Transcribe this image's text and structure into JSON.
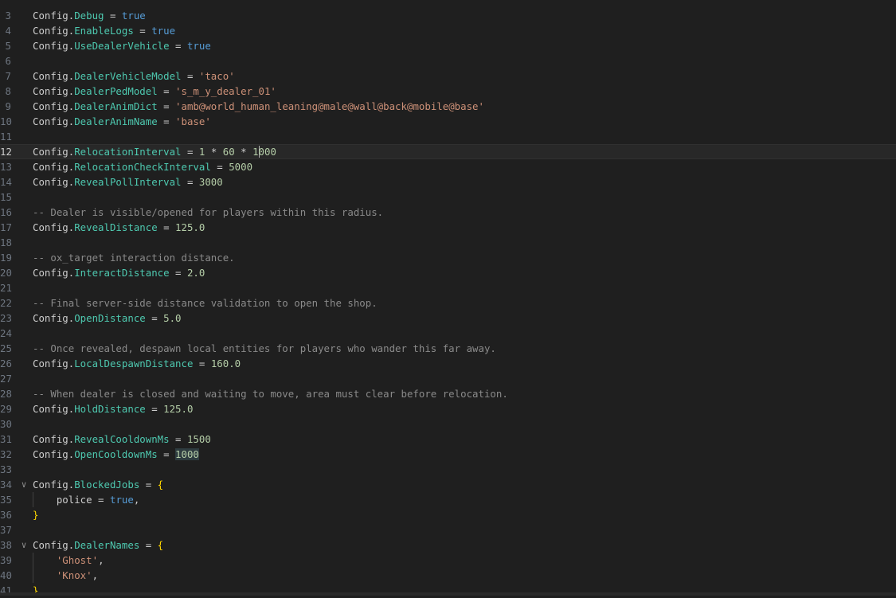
{
  "editor": {
    "cursor_line": "12",
    "lines": [
      {
        "n": "3",
        "tokens": [
          [
            "plain",
            "Config."
          ],
          [
            "prop",
            "Debug"
          ],
          [
            "plain",
            " = "
          ],
          [
            "bool",
            "true"
          ]
        ]
      },
      {
        "n": "4",
        "tokens": [
          [
            "plain",
            "Config."
          ],
          [
            "prop",
            "EnableLogs"
          ],
          [
            "plain",
            " = "
          ],
          [
            "bool",
            "true"
          ]
        ]
      },
      {
        "n": "5",
        "tokens": [
          [
            "plain",
            "Config."
          ],
          [
            "prop",
            "UseDealerVehicle"
          ],
          [
            "plain",
            " = "
          ],
          [
            "bool",
            "true"
          ]
        ]
      },
      {
        "n": "6",
        "tokens": []
      },
      {
        "n": "7",
        "tokens": [
          [
            "plain",
            "Config."
          ],
          [
            "prop",
            "DealerVehicleModel"
          ],
          [
            "plain",
            " = "
          ],
          [
            "str",
            "'taco'"
          ]
        ]
      },
      {
        "n": "8",
        "tokens": [
          [
            "plain",
            "Config."
          ],
          [
            "prop",
            "DealerPedModel"
          ],
          [
            "plain",
            " = "
          ],
          [
            "str",
            "'s_m_y_dealer_01'"
          ]
        ]
      },
      {
        "n": "9",
        "tokens": [
          [
            "plain",
            "Config."
          ],
          [
            "prop",
            "DealerAnimDict"
          ],
          [
            "plain",
            " = "
          ],
          [
            "str",
            "'amb@world_human_leaning@male@wall@back@mobile@base'"
          ]
        ]
      },
      {
        "n": "10",
        "tokens": [
          [
            "plain",
            "Config."
          ],
          [
            "prop",
            "DealerAnimName"
          ],
          [
            "plain",
            " = "
          ],
          [
            "str",
            "'base'"
          ]
        ]
      },
      {
        "n": "11",
        "tokens": []
      },
      {
        "n": "12",
        "tokens": [
          [
            "plain",
            "Config."
          ],
          [
            "prop",
            "RelocationInterval"
          ],
          [
            "plain",
            " = "
          ],
          [
            "num",
            "1"
          ],
          [
            "plain",
            " * "
          ],
          [
            "num",
            "60"
          ],
          [
            "plain",
            " * "
          ],
          [
            "num",
            "1"
          ],
          [
            "cursor",
            ""
          ],
          [
            "num",
            "000"
          ]
        ]
      },
      {
        "n": "13",
        "tokens": [
          [
            "plain",
            "Config."
          ],
          [
            "prop",
            "RelocationCheckInterval"
          ],
          [
            "plain",
            " = "
          ],
          [
            "num",
            "5000"
          ]
        ]
      },
      {
        "n": "14",
        "tokens": [
          [
            "plain",
            "Config."
          ],
          [
            "prop",
            "RevealPollInterval"
          ],
          [
            "plain",
            " = "
          ],
          [
            "num",
            "3000"
          ]
        ]
      },
      {
        "n": "15",
        "tokens": []
      },
      {
        "n": "16",
        "tokens": [
          [
            "com",
            "-- Dealer is visible/opened for players within this radius."
          ]
        ]
      },
      {
        "n": "17",
        "tokens": [
          [
            "plain",
            "Config."
          ],
          [
            "prop",
            "RevealDistance"
          ],
          [
            "plain",
            " = "
          ],
          [
            "num",
            "125.0"
          ]
        ]
      },
      {
        "n": "18",
        "tokens": []
      },
      {
        "n": "19",
        "tokens": [
          [
            "com",
            "-- ox_target interaction distance."
          ]
        ]
      },
      {
        "n": "20",
        "tokens": [
          [
            "plain",
            "Config."
          ],
          [
            "prop",
            "InteractDistance"
          ],
          [
            "plain",
            " = "
          ],
          [
            "num",
            "2.0"
          ]
        ]
      },
      {
        "n": "21",
        "tokens": []
      },
      {
        "n": "22",
        "tokens": [
          [
            "com",
            "-- Final server-side distance validation to open the shop."
          ]
        ]
      },
      {
        "n": "23",
        "tokens": [
          [
            "plain",
            "Config."
          ],
          [
            "prop",
            "OpenDistance"
          ],
          [
            "plain",
            " = "
          ],
          [
            "num",
            "5.0"
          ]
        ]
      },
      {
        "n": "24",
        "tokens": []
      },
      {
        "n": "25",
        "tokens": [
          [
            "com",
            "-- Once revealed, despawn local entities for players who wander this far away."
          ]
        ]
      },
      {
        "n": "26",
        "tokens": [
          [
            "plain",
            "Config."
          ],
          [
            "prop",
            "LocalDespawnDistance"
          ],
          [
            "plain",
            " = "
          ],
          [
            "num",
            "160.0"
          ]
        ]
      },
      {
        "n": "27",
        "tokens": []
      },
      {
        "n": "28",
        "tokens": [
          [
            "com",
            "-- When dealer is closed and waiting to move, area must clear before relocation."
          ]
        ]
      },
      {
        "n": "29",
        "tokens": [
          [
            "plain",
            "Config."
          ],
          [
            "prop",
            "HoldDistance"
          ],
          [
            "plain",
            " = "
          ],
          [
            "num",
            "125.0"
          ]
        ]
      },
      {
        "n": "30",
        "tokens": []
      },
      {
        "n": "31",
        "tokens": [
          [
            "plain",
            "Config."
          ],
          [
            "prop",
            "RevealCooldownMs"
          ],
          [
            "plain",
            " = "
          ],
          [
            "num",
            "1500"
          ]
        ]
      },
      {
        "n": "32",
        "tokens": [
          [
            "plain",
            "Config."
          ],
          [
            "prop",
            "OpenCooldownMs"
          ],
          [
            "plain",
            " = "
          ],
          [
            "numhl",
            "1000"
          ]
        ]
      },
      {
        "n": "33",
        "tokens": []
      },
      {
        "n": "34",
        "fold": true,
        "tokens": [
          [
            "plain",
            "Config."
          ],
          [
            "prop",
            "BlockedJobs"
          ],
          [
            "plain",
            " = "
          ],
          [
            "brace",
            "{"
          ]
        ]
      },
      {
        "n": "35",
        "guide": true,
        "tokens": [
          [
            "plain",
            "    police = "
          ],
          [
            "bool",
            "true"
          ],
          [
            "plain",
            ","
          ]
        ]
      },
      {
        "n": "36",
        "tokens": [
          [
            "brace",
            "}"
          ]
        ]
      },
      {
        "n": "37",
        "tokens": []
      },
      {
        "n": "38",
        "fold": true,
        "tokens": [
          [
            "plain",
            "Config."
          ],
          [
            "prop",
            "DealerNames"
          ],
          [
            "plain",
            " = "
          ],
          [
            "brace",
            "{"
          ]
        ]
      },
      {
        "n": "39",
        "guide": true,
        "tokens": [
          [
            "plain",
            "    "
          ],
          [
            "str",
            "'Ghost'"
          ],
          [
            "plain",
            ","
          ]
        ]
      },
      {
        "n": "40",
        "guide": true,
        "tokens": [
          [
            "plain",
            "    "
          ],
          [
            "str",
            "'Knox'"
          ],
          [
            "plain",
            ","
          ]
        ]
      },
      {
        "n": "41",
        "tokens": [
          [
            "brace",
            "}"
          ]
        ]
      }
    ]
  }
}
